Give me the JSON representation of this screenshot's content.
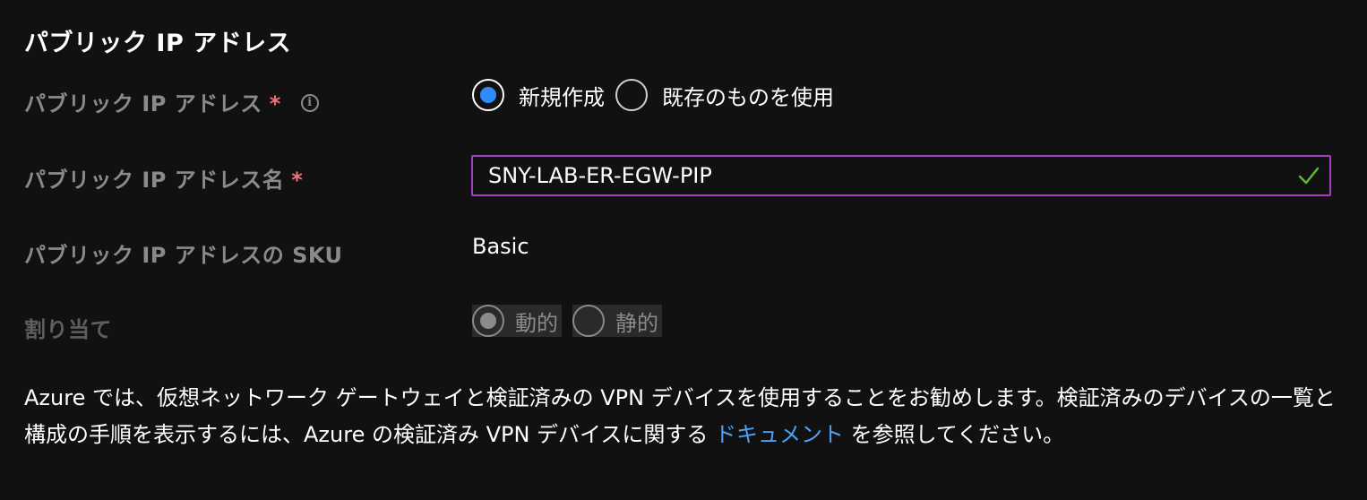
{
  "section": {
    "title": "パブリック IP アドレス"
  },
  "public_ip": {
    "label": "パブリック IP アドレス",
    "required_mark": "*",
    "info_glyph": "i",
    "options": [
      {
        "label": "新規作成",
        "selected": true
      },
      {
        "label": "既存のものを使用",
        "selected": false
      }
    ]
  },
  "public_ip_name": {
    "label": "パブリック IP アドレス名",
    "required_mark": "*",
    "value": "SNY-LAB-ER-EGW-PIP",
    "validation": "valid"
  },
  "public_ip_sku": {
    "label": "パブリック IP アドレスの SKU",
    "value": "Basic"
  },
  "assignment": {
    "label": "割り当て",
    "disabled": true,
    "options": [
      {
        "label": "動的",
        "selected": true
      },
      {
        "label": "静的",
        "selected": false
      }
    ]
  },
  "info": {
    "text_before": "Azure では、仮想ネットワーク ゲートウェイと検証済みの VPN デバイスを使用することをお勧めします。検証済みのデバイスの一覧と構成の手順を表示するには、Azure の検証済み VPN デバイスに関する ",
    "link_text": "ドキュメント",
    "text_after": " を参照してください。"
  },
  "colors": {
    "background": "#111111",
    "accent_blue": "#2f8cff",
    "link_blue": "#4ea3f5",
    "focus_border": "#a33dc4",
    "valid_check": "#5fb832",
    "required_red": "#f1707b",
    "label_gray": "#8a8a8a"
  },
  "icons": {
    "info": "info-icon",
    "validation": "checkmark-icon"
  }
}
